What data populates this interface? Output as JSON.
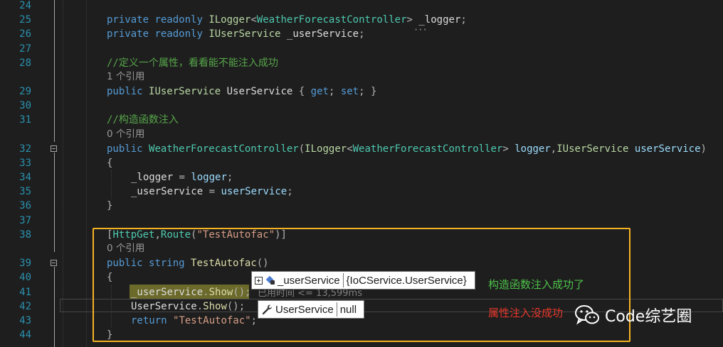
{
  "line_numbers": [
    "24",
    "25",
    "26",
    "27",
    "28",
    "29",
    "30",
    "31",
    "32",
    "33",
    "34",
    "35",
    "36",
    "37",
    "38",
    "39",
    "40",
    "41",
    "42",
    "43",
    "44"
  ],
  "code": {
    "l25": {
      "kw1": "private",
      "kw2": "readonly",
      "ty1": "ILogger",
      "lt": "<",
      "ty2": "WeatherForecastController",
      "gt": ">",
      "id": "_logger",
      "semi": ";"
    },
    "l26": {
      "kw1": "private",
      "kw2": "readonly",
      "ty1": "IUserService",
      "id": "_userService",
      "semi": ";"
    },
    "l28_comment": "//定义一个属性，看看能不能注入成功",
    "l28_refs": "1 个引用",
    "l29": {
      "kw1": "public",
      "ty1": "IUserService",
      "id": "UserService",
      "ob": "{",
      "get": "get",
      "s1": ";",
      "set": "set",
      "s2": ";",
      "cb": "}"
    },
    "l31_comment": "//构造函数注入",
    "l31_refs": "0 个引用",
    "l32": {
      "kw1": "public",
      "name": "WeatherForecastController",
      "p1": "(",
      "ty1": "ILogger",
      "lt": "<",
      "ty2": "WeatherForecastController",
      "gt": ">",
      "a1": "logger",
      "comma": ",",
      "ty3": "IUserService",
      "a2": "userService",
      "p2": ")"
    },
    "l33": "{",
    "l34": {
      "lhs": "_logger",
      "eq": "=",
      "rhs": "logger",
      "semi": ";"
    },
    "l35": {
      "lhs": "_userService",
      "eq": "=",
      "rhs": "userService",
      "semi": ";"
    },
    "l36": "}",
    "l38": {
      "ob": "[",
      "a1": "HttpGet",
      "comma": ",",
      "a2": "Route",
      "p1": "(",
      "str": "\"TestAutofac\"",
      "p2": ")",
      "cb": "]"
    },
    "l38_refs": "0 个引用",
    "l39": {
      "kw1": "public",
      "kw2": "string",
      "fn": "TestAutofac",
      "parens": "()"
    },
    "l40": "{",
    "l41": {
      "obj": "_userService",
      "dot": ".",
      "fn": "Show",
      "call": "();"
    },
    "l42": {
      "obj": "UserService",
      "dot": ".",
      "fn": "Show",
      "call": "();"
    },
    "l43": {
      "kw": "return",
      "str": "\"TestAutofac\"",
      "semi": ";"
    },
    "l44": "}"
  },
  "datatip1": {
    "name": "_userService",
    "value": "{IoCService.UserService}"
  },
  "datatip2": {
    "name": "UserService",
    "value": "null"
  },
  "elapsed": "已用时间 <= 13,599ms",
  "annotations": {
    "success": "构造函数注入成功了",
    "fail": "属性注入没成功"
  },
  "watermark": "Code综艺圈",
  "colors": {
    "highlight_box": "#f5b324",
    "annot_success": "#4ec24a",
    "annot_fail": "#e8372a"
  }
}
